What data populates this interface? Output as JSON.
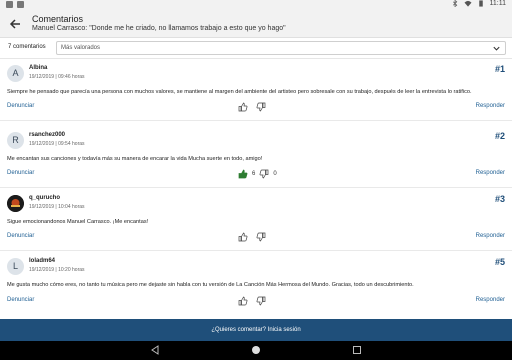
{
  "status_bar": {
    "time": "11:11"
  },
  "header": {
    "title": "Comentarios",
    "subtitle": "Manuel Carrasco: \"Donde me he criado, no llamamos trabajo a esto que yo hago\""
  },
  "filter": {
    "count_label": "7 comentarios",
    "sort_value": "Más valorados"
  },
  "actions": {
    "report": "Denunciar",
    "reply": "Responder"
  },
  "comments": [
    {
      "initial": "A",
      "author": "Albina",
      "date": "19/12/2019 | 09:46 horas",
      "number": "#1",
      "text": "Siempre he pensado que parecía una persona con muchos valores, se mantiene al margen del ambiente del artisteo pero sobresale con su trabajo, después de leer la entrevista lo ratifico.",
      "likes": "",
      "dislikes": ""
    },
    {
      "initial": "R",
      "author": "rsanchez000",
      "date": "19/12/2019 | 09:54 horas",
      "number": "#2",
      "text": "Me encantan sus canciones y todavía más su manera de encarar la vida Mucha suerte en todo, amigo!",
      "likes": "6",
      "dislikes": "0"
    },
    {
      "initial": "",
      "author": "q_qurucho",
      "date": "19/12/2019 | 10:04 horas",
      "number": "#3",
      "text": "Sigue emocionandonos Manuel Carrasco. ¡Me encantas!",
      "likes": "",
      "dislikes": ""
    },
    {
      "initial": "L",
      "author": "loladm64",
      "date": "19/12/2019 | 10:20 horas",
      "number": "#5",
      "text": "Me gusta mucho cómo eres, no tanto tu música pero me dejaste sin habla con tu versión de La Canción Más Hermosa del Mundo. Gracias, todo un descubrimiento.",
      "likes": "",
      "dislikes": ""
    }
  ],
  "footer": {
    "login_prompt": "¿Quieres comentar? Inicia sesión"
  },
  "colors": {
    "accent": "#1f4f7a",
    "like_active": "#2e7d32"
  }
}
